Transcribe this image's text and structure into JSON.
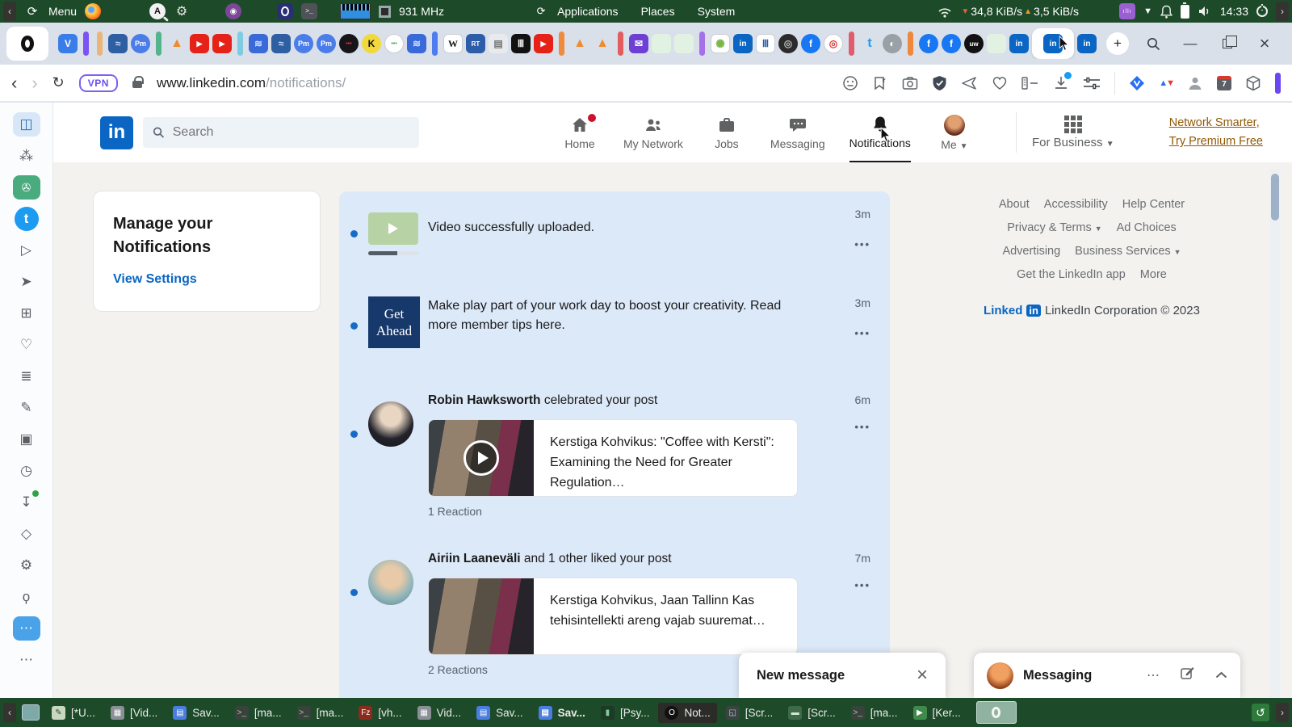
{
  "system_bar": {
    "menu_label": "Menu",
    "cpu_freq": "931 MHz",
    "menus": [
      "Applications",
      "Places",
      "System"
    ],
    "net_down": "34,8 KiB/s",
    "net_up": "3,5 KiB/s",
    "clock": "14:33"
  },
  "browser": {
    "vpn_badge": "VPN",
    "url_domain": "www.linkedin.com",
    "url_path": "/notifications/",
    "ext_calendar_day": "7",
    "tabs": [
      {
        "icon": "vivaldi-icon"
      },
      {
        "sep": "#7a52f5"
      },
      {
        "sep": "#ecb577"
      },
      {
        "icon": "waves-blue-icon"
      },
      {
        "icon": "protonmail-icon"
      },
      {
        "sep": "#54b58c"
      },
      {
        "icon": "fox-icon"
      },
      {
        "icon": "youtube-icon"
      },
      {
        "icon": "youtube-icon"
      },
      {
        "sep": "#7ecbe2"
      },
      {
        "icon": "pattern-blue-icon"
      },
      {
        "icon": "waves-blue-icon"
      },
      {
        "icon": "protonmail-icon"
      },
      {
        "icon": "protonmail-icon"
      },
      {
        "icon": "dots-red-black-icon"
      },
      {
        "icon": "k-yellow-icon"
      },
      {
        "icon": "dots-green-icon"
      },
      {
        "icon": "pattern-blue-icon"
      },
      {
        "sep": "#4f7df0"
      },
      {
        "icon": "wikipedia-icon"
      },
      {
        "icon": "rt-icon"
      },
      {
        "icon": "doc-gray-icon"
      },
      {
        "icon": "archive-museum-icon"
      },
      {
        "icon": "youtube-icon"
      },
      {
        "sep": "#f08a3c"
      },
      {
        "icon": "fox-icon"
      },
      {
        "icon": "fox-icon"
      },
      {
        "sep": "#e25d5d"
      },
      {
        "icon": "mail-purple-icon"
      },
      {
        "icon": "pale-tab"
      },
      {
        "icon": "pale-tab"
      },
      {
        "sep": "#a570e8"
      },
      {
        "icon": "spiral-icon"
      },
      {
        "icon": "linkedin-icon"
      },
      {
        "icon": "museum-blue-icon"
      },
      {
        "icon": "camera-dark-icon"
      },
      {
        "icon": "facebook-icon"
      },
      {
        "icon": "target-red-icon"
      },
      {
        "sep": "#e25d6b"
      },
      {
        "icon": "twitter-icon"
      },
      {
        "icon": "globe-gray-icon"
      },
      {
        "sep": "#f0883c"
      },
      {
        "icon": "facebook-icon"
      },
      {
        "icon": "facebook-icon"
      },
      {
        "icon": "uw-black-icon"
      },
      {
        "icon": "pale-tab"
      },
      {
        "icon": "linkedin-icon"
      },
      {
        "icon": "linkedin-icon",
        "active": true
      },
      {
        "icon": "linkedin-icon"
      },
      {
        "icon": "wordmark-w-icon"
      }
    ],
    "rail": [
      {
        "name": "reading-list-icon",
        "g": "◫",
        "style": "active-blue"
      },
      {
        "name": "paw-icon",
        "g": "⁂"
      },
      {
        "name": "chatgpt-icon",
        "g": "✇",
        "style": "green-app"
      },
      {
        "name": "twitter-icon",
        "g": "t",
        "style": "twitter"
      },
      {
        "name": "play-circle-icon",
        "g": "▷"
      },
      {
        "name": "send-icon",
        "g": "➤"
      },
      {
        "name": "apps-grid-icon",
        "g": "⊞"
      },
      {
        "name": "heart-icon",
        "g": "♡"
      },
      {
        "name": "news-icon",
        "g": "≣"
      },
      {
        "name": "compose-icon",
        "g": "✎"
      },
      {
        "name": "window-icon",
        "g": "▣"
      },
      {
        "name": "history-icon",
        "g": "◷"
      },
      {
        "name": "downloads-icon",
        "g": "↧",
        "dot": true
      },
      {
        "name": "extensions-icon",
        "g": "◇"
      },
      {
        "name": "settings-icon",
        "g": "⚙"
      },
      {
        "name": "lightbulb-icon",
        "g": "ϙ"
      },
      {
        "name": "chat-bubble-icon",
        "g": "⋯",
        "style": "blue-app"
      },
      {
        "name": "more-icon",
        "g": "⋯"
      }
    ]
  },
  "linkedin": {
    "search_placeholder": "Search",
    "nav": [
      {
        "label": "Home",
        "icon": "home"
      },
      {
        "label": "My Network",
        "icon": "network"
      },
      {
        "label": "Jobs",
        "icon": "jobs"
      },
      {
        "label": "Messaging",
        "icon": "messaging"
      },
      {
        "label": "Notifications",
        "icon": "bell",
        "active": true
      },
      {
        "label": "Me",
        "icon": "me"
      }
    ],
    "for_business": "For Business",
    "premium_line1": "Network Smarter,",
    "premium_line2": "Try Premium Free",
    "manage_title": "Manage your Notifications",
    "manage_link": "View Settings",
    "notifications": [
      {
        "text": "Video successfully uploaded.",
        "time": "3m"
      },
      {
        "thumb_line1": "Get",
        "thumb_line2": "Ahead",
        "text": "Make play part of your work day to boost your creativity. Read more member tips here.",
        "time": "3m"
      },
      {
        "actor": "Robin Hawksworth",
        "action": "celebrated your post",
        "time": "6m",
        "post_title": "Kerstiga Kohvikus: \"Coffee with Kersti\": Examining the Need for Greater Regulation…",
        "reactions": "1 Reaction"
      },
      {
        "actor": "Airiin Laaneväli",
        "action": "and 1 other liked your post",
        "time": "7m",
        "post_title": "Kerstiga Kohvikus, Jaan Tallinn Kas tehisintellekti areng vajab suuremat…",
        "reactions": "2 Reactions"
      }
    ],
    "footer": {
      "rows": [
        [
          {
            "label": "About"
          },
          {
            "label": "Accessibility"
          },
          {
            "label": "Help Center"
          }
        ],
        [
          {
            "label": "Privacy & Terms",
            "caret": true
          },
          {
            "label": "Ad Choices"
          }
        ],
        [
          {
            "label": "Advertising"
          },
          {
            "label": "Business Services",
            "caret": true
          }
        ],
        [
          {
            "label": "Get the LinkedIn app"
          },
          {
            "label": "More"
          }
        ]
      ],
      "logo_word": "Linked",
      "logo_badge": "in",
      "copyright": "LinkedIn Corporation © 2023"
    },
    "new_message_title": "New message",
    "messaging_title": "Messaging"
  },
  "taskbar": {
    "buttons": [
      {
        "icon": "text-editor-icon",
        "label": "[*U..."
      },
      {
        "icon": "archive-icon",
        "label": "[Vid..."
      },
      {
        "icon": "remote-viewer-icon",
        "label": "Sav..."
      },
      {
        "icon": "terminal-icon",
        "label": "[ma..."
      },
      {
        "icon": "terminal-icon",
        "label": "[ma..."
      },
      {
        "icon": "filezilla-icon",
        "label": "[vh..."
      },
      {
        "icon": "archive-icon",
        "label": "Vid..."
      },
      {
        "icon": "remote-viewer-icon",
        "label": "Sav..."
      },
      {
        "icon": "remote-viewer-icon",
        "label": "Sav...",
        "bold": true
      },
      {
        "icon": "app-green-icon",
        "label": "[Psy..."
      },
      {
        "icon": "opera-icon",
        "label": "Not...",
        "active": true
      },
      {
        "icon": "screenshot-icon",
        "label": "[Scr..."
      },
      {
        "icon": "folder-green-icon",
        "label": "[Scr..."
      },
      {
        "icon": "terminal-icon",
        "label": "[ma..."
      },
      {
        "icon": "media-player-icon",
        "label": "[Ker..."
      }
    ]
  }
}
